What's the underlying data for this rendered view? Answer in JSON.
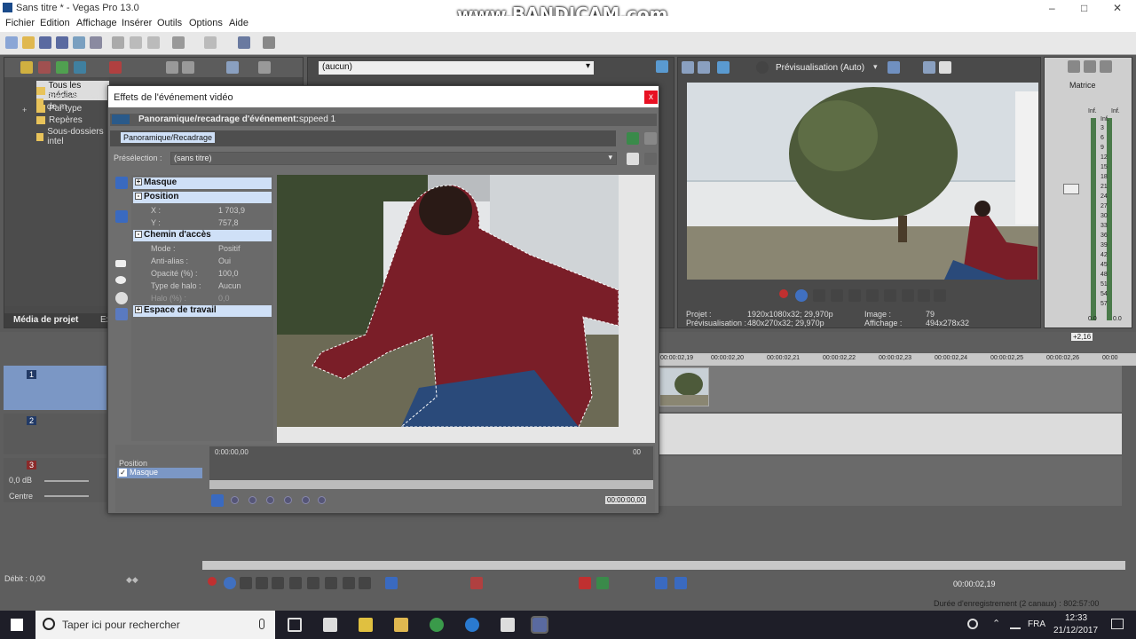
{
  "window": {
    "title": "Sans titre * - Vegas Pro 13.0",
    "watermark": "www.BANDICAM.com"
  },
  "menu": [
    "Fichier",
    "Edition",
    "Affichage",
    "Insérer",
    "Outils",
    "Options",
    "Aide"
  ],
  "project_media": {
    "tree": [
      "Tous les médias",
      "Sous-dossiers de m",
      "Par type",
      "Repères",
      "Sous-dossiers intel"
    ],
    "tab": "Média de projet",
    "tab2": "Ex"
  },
  "fx_dropdown": "(aucun)",
  "preview": {
    "mode": "Prévisualisation (Auto)",
    "projet_label": "Projet :",
    "projet_value": "1920x1080x32; 29,970p",
    "prev_label": "Prévisualisation :",
    "prev_value": "480x270x32; 29,970p",
    "image_label": "Image :",
    "image_value": "79",
    "affichage_label": "Affichage :",
    "affichage_value": "494x278x32"
  },
  "mixer": {
    "label": "Matrice",
    "ticks": [
      "Inf.",
      "3",
      "6",
      "9",
      "12",
      "15",
      "18",
      "21",
      "24",
      "27",
      "30",
      "33",
      "36",
      "39",
      "42",
      "45",
      "48",
      "51",
      "54",
      "57"
    ],
    "bottom": [
      "0.0",
      "0.0"
    ],
    "inf_top": [
      "Inf.",
      "Inf."
    ]
  },
  "dialog": {
    "title": "Effets de l'événement vidéo",
    "close": "x",
    "chain_label": "Panoramique/recadrage d'événement:",
    "chain_name": "sppeed 1",
    "plugin_tab": "Panoramique/Recadrage",
    "preset_label": "Présélection :",
    "preset_value": "(sans titre)",
    "sections": {
      "masque": "Masque",
      "position": "Position",
      "x_label": "X :",
      "x_value": "1 703,9",
      "y_label": "Y :",
      "y_value": "757,8",
      "chemin": "Chemin d'accès",
      "mode_label": "Mode :",
      "mode_value": "Positif",
      "aa_label": "Anti-alias :",
      "aa_value": "Oui",
      "op_label": "Opacité (%) :",
      "op_value": "100,0",
      "halo_label": "Type de halo :",
      "halo_value": "Aucun",
      "halop_label": "Halo (%) :",
      "halop_value": "0,0",
      "espace": "Espace de travail"
    },
    "kf_tracks": [
      "Position",
      "Masque"
    ],
    "kf_time_start": "0:00:00,00",
    "kf_time_end": "00",
    "kf_cursor_time": "00:00:00,00"
  },
  "timeline": {
    "ruler": [
      "00:00:02,19",
      "00:00:02,20",
      "00:00:02,21",
      "00:00:02,22",
      "00:00:02,23",
      "00:00:02,24",
      "00:00:02,25",
      "00:00:02,26",
      "00:00"
    ],
    "rate": "+2,16",
    "tracks": [
      "1",
      "2",
      "3"
    ],
    "audio_db": "0,0 dB",
    "audio_pan": "Centre",
    "rate_label": "Débit : 0,00",
    "cursor_time": "00:00:02,19",
    "status": "Durée d'enregistrement (2 canaux) : 802:57:00"
  },
  "taskbar": {
    "search": "Taper ici pour rechercher",
    "lang": "FRA",
    "time": "12:33",
    "date": "21/12/2017"
  }
}
